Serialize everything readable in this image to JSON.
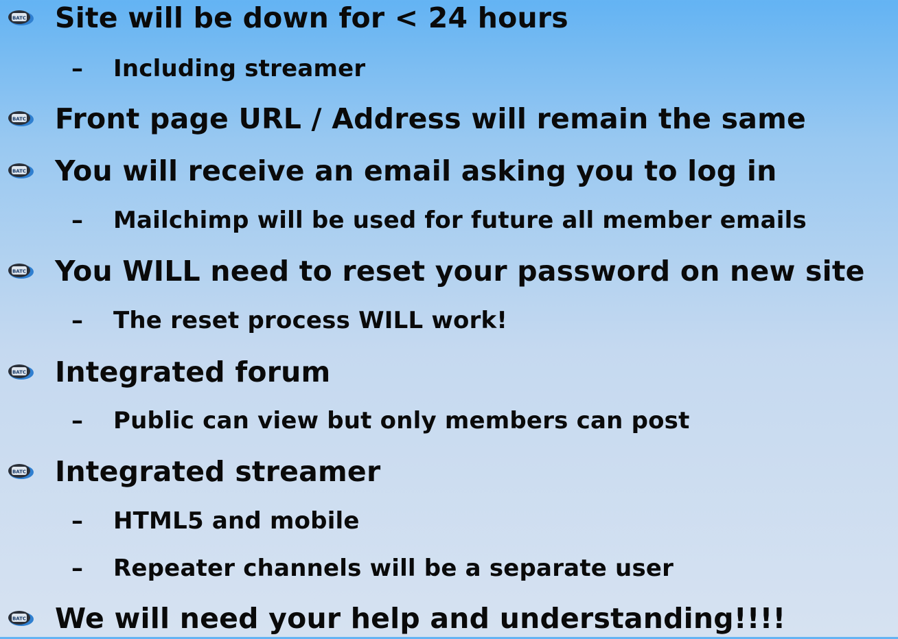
{
  "bullet_icon": {
    "name": "bato-logo-icon",
    "badge_text": "BATC",
    "colors": {
      "outer": "#2a2f38",
      "swoosh": "#2f7fd0",
      "badge": "#dfe6ee",
      "badge_text": "#1a3c6a"
    }
  },
  "items": [
    {
      "level": 1,
      "text": "Site will be down for < 24 hours"
    },
    {
      "level": 2,
      "dash": "–",
      "text": "Including streamer"
    },
    {
      "level": 1,
      "text": "Front page URL / Address will remain the same"
    },
    {
      "level": 1,
      "text": "You will receive an email asking you to log in"
    },
    {
      "level": 2,
      "dash": "–",
      "text": "Mailchimp will be used for future all member emails"
    },
    {
      "level": 1,
      "text": "You WILL need to reset your password on new site"
    },
    {
      "level": 2,
      "dash": "–",
      "text": "The reset process WILL work!"
    },
    {
      "level": 1,
      "text": "Integrated forum"
    },
    {
      "level": 2,
      "dash": "–",
      "text": "Public can view but only members can post"
    },
    {
      "level": 1,
      "text": "Integrated streamer"
    },
    {
      "level": 2,
      "dash": "–",
      "text": "HTML5 and mobile"
    },
    {
      "level": 2,
      "dash": "–",
      "text": "Repeater channels will be a separate user"
    },
    {
      "level": 1,
      "text": "We will need your help and understanding!!!!"
    }
  ]
}
